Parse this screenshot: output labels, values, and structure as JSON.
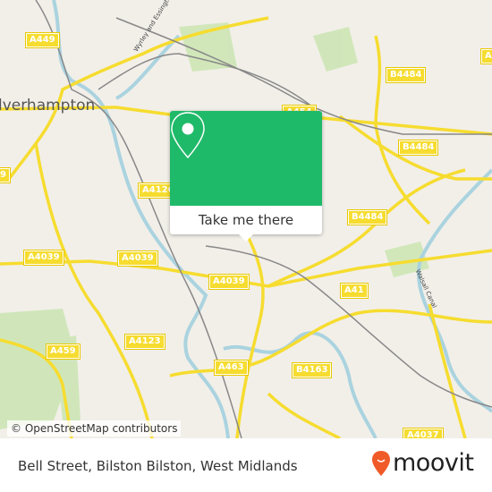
{
  "map": {
    "city_label": "lverhampton",
    "road_labels": [
      "A449",
      "A454",
      "B4484",
      "B4484",
      "A4126",
      "B4484",
      "A4039",
      "A4039",
      "A4039",
      "A41",
      "A4123",
      "A459",
      "A463",
      "B4163",
      "A4037",
      "9",
      "A4"
    ],
    "canal_labels": [
      "Wyrley and Essington Canal",
      "Walsall Canal"
    ],
    "attribution": "© OpenStreetMap contributors",
    "colors": {
      "land": "#f2efe9",
      "road": "#f6dc2f",
      "water": "#aad3df",
      "park": "#cde6b5"
    }
  },
  "popup": {
    "icon": "map-pin-icon",
    "button_label": "Take me there",
    "color": "#1fba69"
  },
  "footer": {
    "address": "Bell Street, Bilston Bilston, West Midlands",
    "logo_text": "moovit",
    "logo_color": "#f05a28"
  }
}
